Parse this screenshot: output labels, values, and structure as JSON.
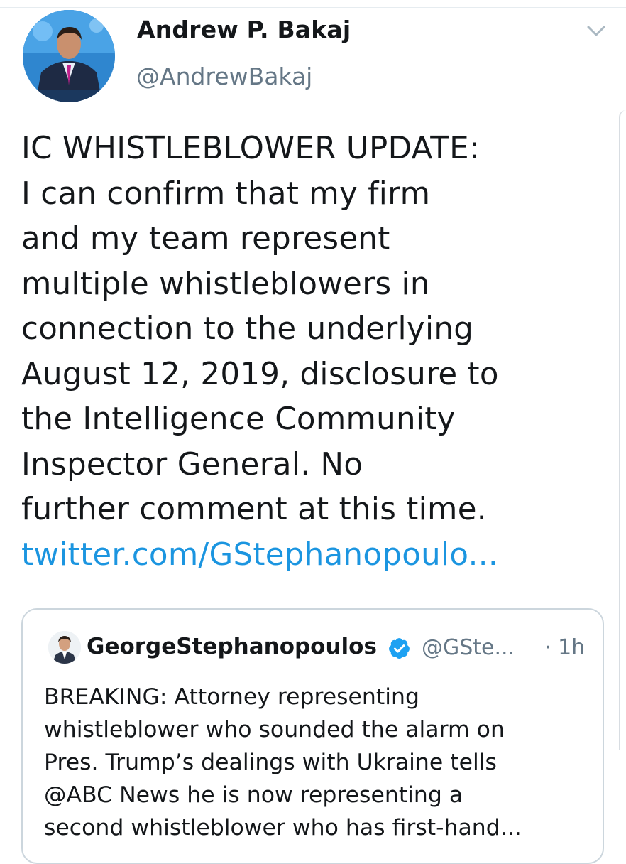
{
  "tweet": {
    "author_name": "Andrew P. Bakaj",
    "author_handle": "@AndrewBakaj",
    "text_lines": [
      "IC WHISTLEBLOWER UPDATE:",
      "I can confirm that my firm",
      "and my team represent",
      "multiple whistleblowers in",
      "connection to the underlying",
      "August 12, 2019, disclosure to",
      "the Intelligence Community",
      "Inspector General. No",
      "further comment at this time."
    ],
    "link_text": "twitter.com/GStephanopoulo..."
  },
  "quoted_tweet": {
    "author_name": "GeorgeStephanopoulos",
    "author_handle": "@GSte...",
    "time": "· 1h",
    "text_lines": [
      "BREAKING: Attorney representing",
      "whistleblower who sounded the alarm on",
      "Pres. Trump’s dealings with Ukraine tells",
      "@ABC News he is now representing a",
      "second whistleblower who has first-hand..."
    ]
  },
  "icons": {
    "menu": "chevron-down-icon",
    "verified": "verified-badge-icon"
  },
  "colors": {
    "link": "#1b95e0",
    "verified": "#1da1f2",
    "secondary_text": "#657786",
    "border": "#ccd6dd"
  }
}
